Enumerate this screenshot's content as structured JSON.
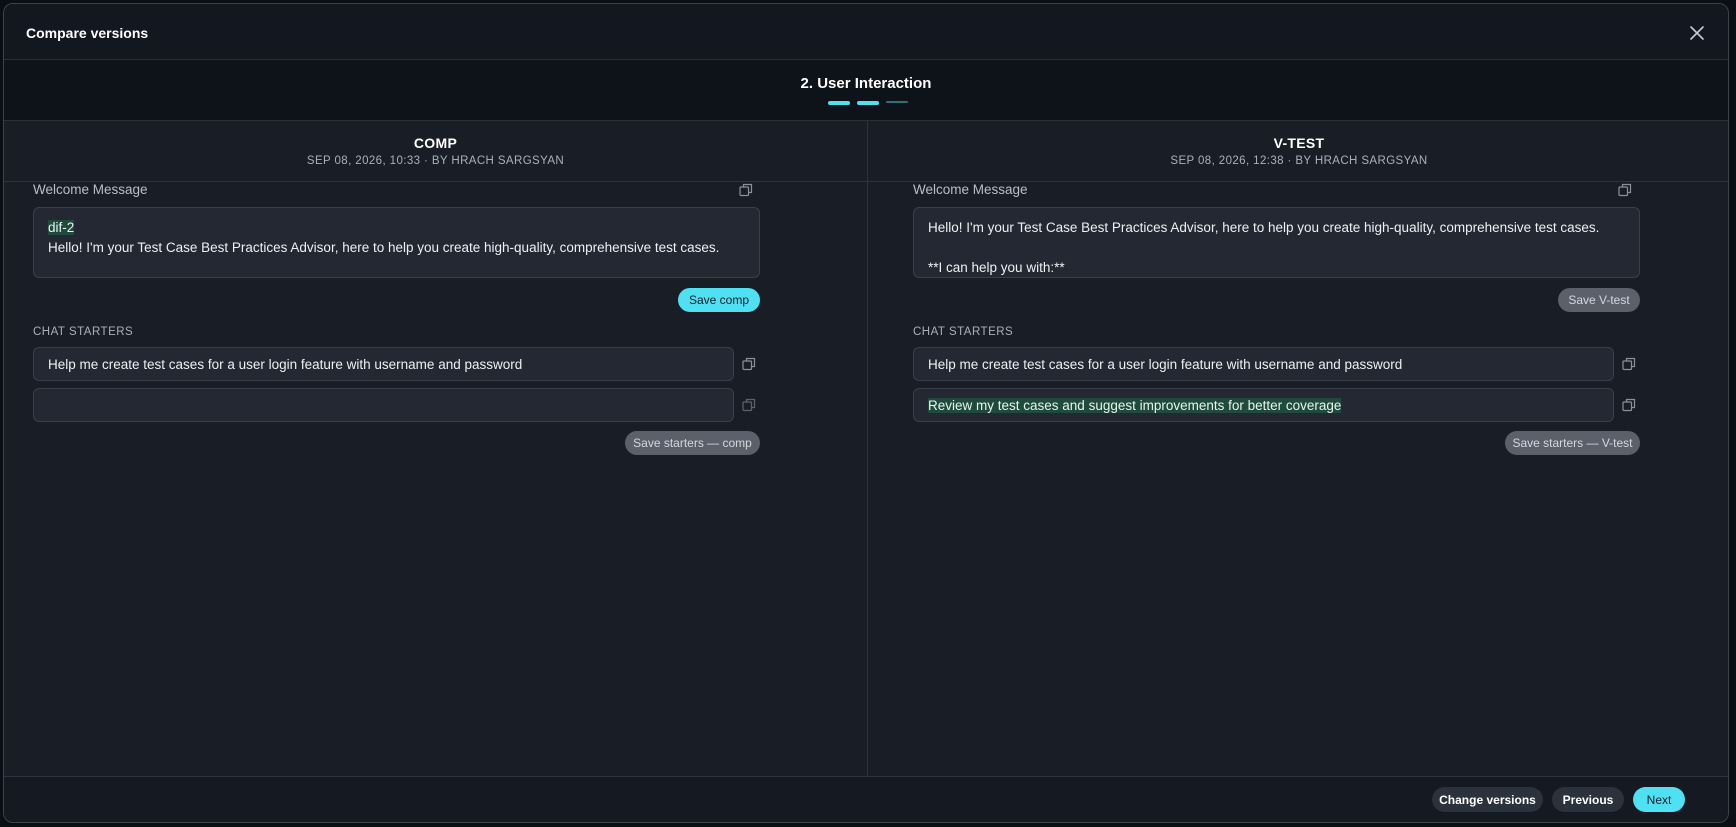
{
  "dialog": {
    "title": "Compare versions",
    "close_icon": "close-icon"
  },
  "stepper": {
    "title": "2. User Interaction",
    "steps_total": 3,
    "current_step": 2,
    "active_color": "#4fe0f2",
    "inactive_color": "#2f6f78"
  },
  "left": {
    "version_name": "COMP",
    "meta": "SEP 08, 2026, 10:33 · BY HRACH SARGSYAN",
    "welcome_label": "Welcome Message",
    "welcome_highlight": "dif-2",
    "welcome_text": "Hello! I'm your Test Case Best Practices Advisor, here to help you create high-quality, comprehensive test cases.",
    "save_button": "Save comp",
    "starters_label": "CHAT STARTERS",
    "starters": [
      "Help me create test cases for a user login feature with username and password",
      ""
    ],
    "save_starters_button": "Save starters — comp"
  },
  "right": {
    "version_name": "V-TEST",
    "meta": "SEP 08, 2026, 12:38 · BY HRACH SARGSYAN",
    "welcome_label": "Welcome Message",
    "welcome_line1": "Hello! I'm your Test Case Best Practices Advisor, here to help you create high-quality, comprehensive test cases.",
    "welcome_line2": "**I can help you with:**",
    "save_button": "Save V-test",
    "starters_label": "CHAT STARTERS",
    "starters": [
      "Help me create test cases for a user login feature with username and password",
      "Review my test cases and suggest improvements for better coverage"
    ],
    "save_starters_button": "Save starters — V-test"
  },
  "footer": {
    "change_versions": "Change versions",
    "previous": "Previous",
    "next": "Next"
  }
}
